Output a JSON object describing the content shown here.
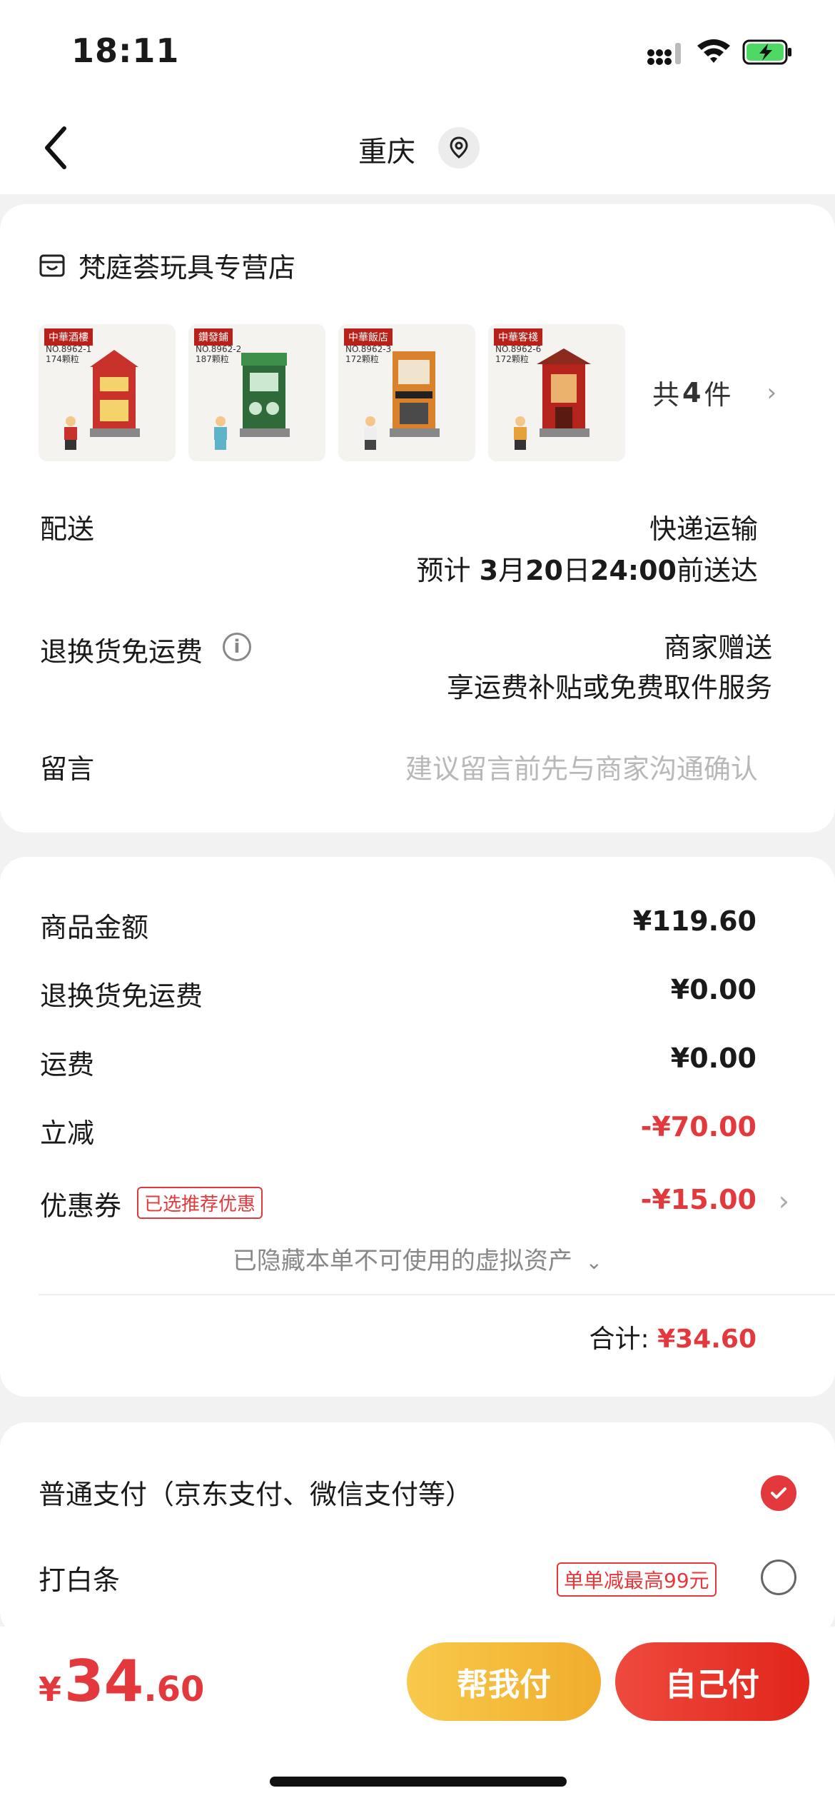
{
  "status_bar": {
    "time": "18:11"
  },
  "nav": {
    "title": "重庆"
  },
  "shop": {
    "name": "梵庭荟玩具专营店"
  },
  "products": {
    "thumbs": [
      {
        "tag": "中華酒樓",
        "no": "NO.8962-1",
        "pcs": "174颗粒",
        "color": "#c8322a"
      },
      {
        "tag": "鑽發鋪",
        "no": "NO.8962-2",
        "pcs": "187颗粒",
        "color": "#3d8f4a"
      },
      {
        "tag": "中華飯店",
        "no": "NO.8962-3",
        "pcs": "172颗粒",
        "color": "#d9822b"
      },
      {
        "tag": "中華客棧",
        "no": "NO.8962-6",
        "pcs": "172颗粒",
        "color": "#b4231c"
      }
    ],
    "count_prefix": "共",
    "count_num": "4",
    "count_suffix": "件"
  },
  "delivery": {
    "label": "配送",
    "method": "快递运输",
    "estimate_prefix": "预计",
    "estimate_date": "3",
    "estimate_month": "月",
    "estimate_day": "20",
    "estimate_day_suffix": "日",
    "estimate_time": "24:00",
    "estimate_suffix": "前送达"
  },
  "return_shipping": {
    "label": "退换货免运费",
    "value": "商家赠送",
    "sub": "享运费补贴或免费取件服务"
  },
  "message": {
    "label": "留言",
    "placeholder": "建议留言前先与商家沟通确认"
  },
  "amounts": {
    "goods_label": "商品金额",
    "goods_value": "¥119.60",
    "return_label": "退换货免运费",
    "return_value": "¥0.00",
    "shipping_label": "运费",
    "shipping_value": "¥0.00",
    "discount_label": "立减",
    "discount_value": "-¥70.00",
    "coupon_label": "优惠券",
    "coupon_tag": "已选推荐优惠",
    "coupon_value": "-¥15.00",
    "hidden_note": "已隐藏本单不可使用的虚拟资产",
    "total_label": "合计:",
    "total_value": "¥34.60"
  },
  "payment": {
    "normal_label": "普通支付（京东支付、微信支付等）",
    "baitiao_label": "打白条",
    "baitiao_promo": "单单减最高99元"
  },
  "bottom": {
    "currency": "¥",
    "price_int": "34",
    "price_dec": ".60",
    "help_pay": "帮我付",
    "self_pay": "自己付"
  },
  "colors": {
    "accent": "#e4393c",
    "help_btn": "#f5b93a",
    "self_btn": "#e1251b"
  }
}
